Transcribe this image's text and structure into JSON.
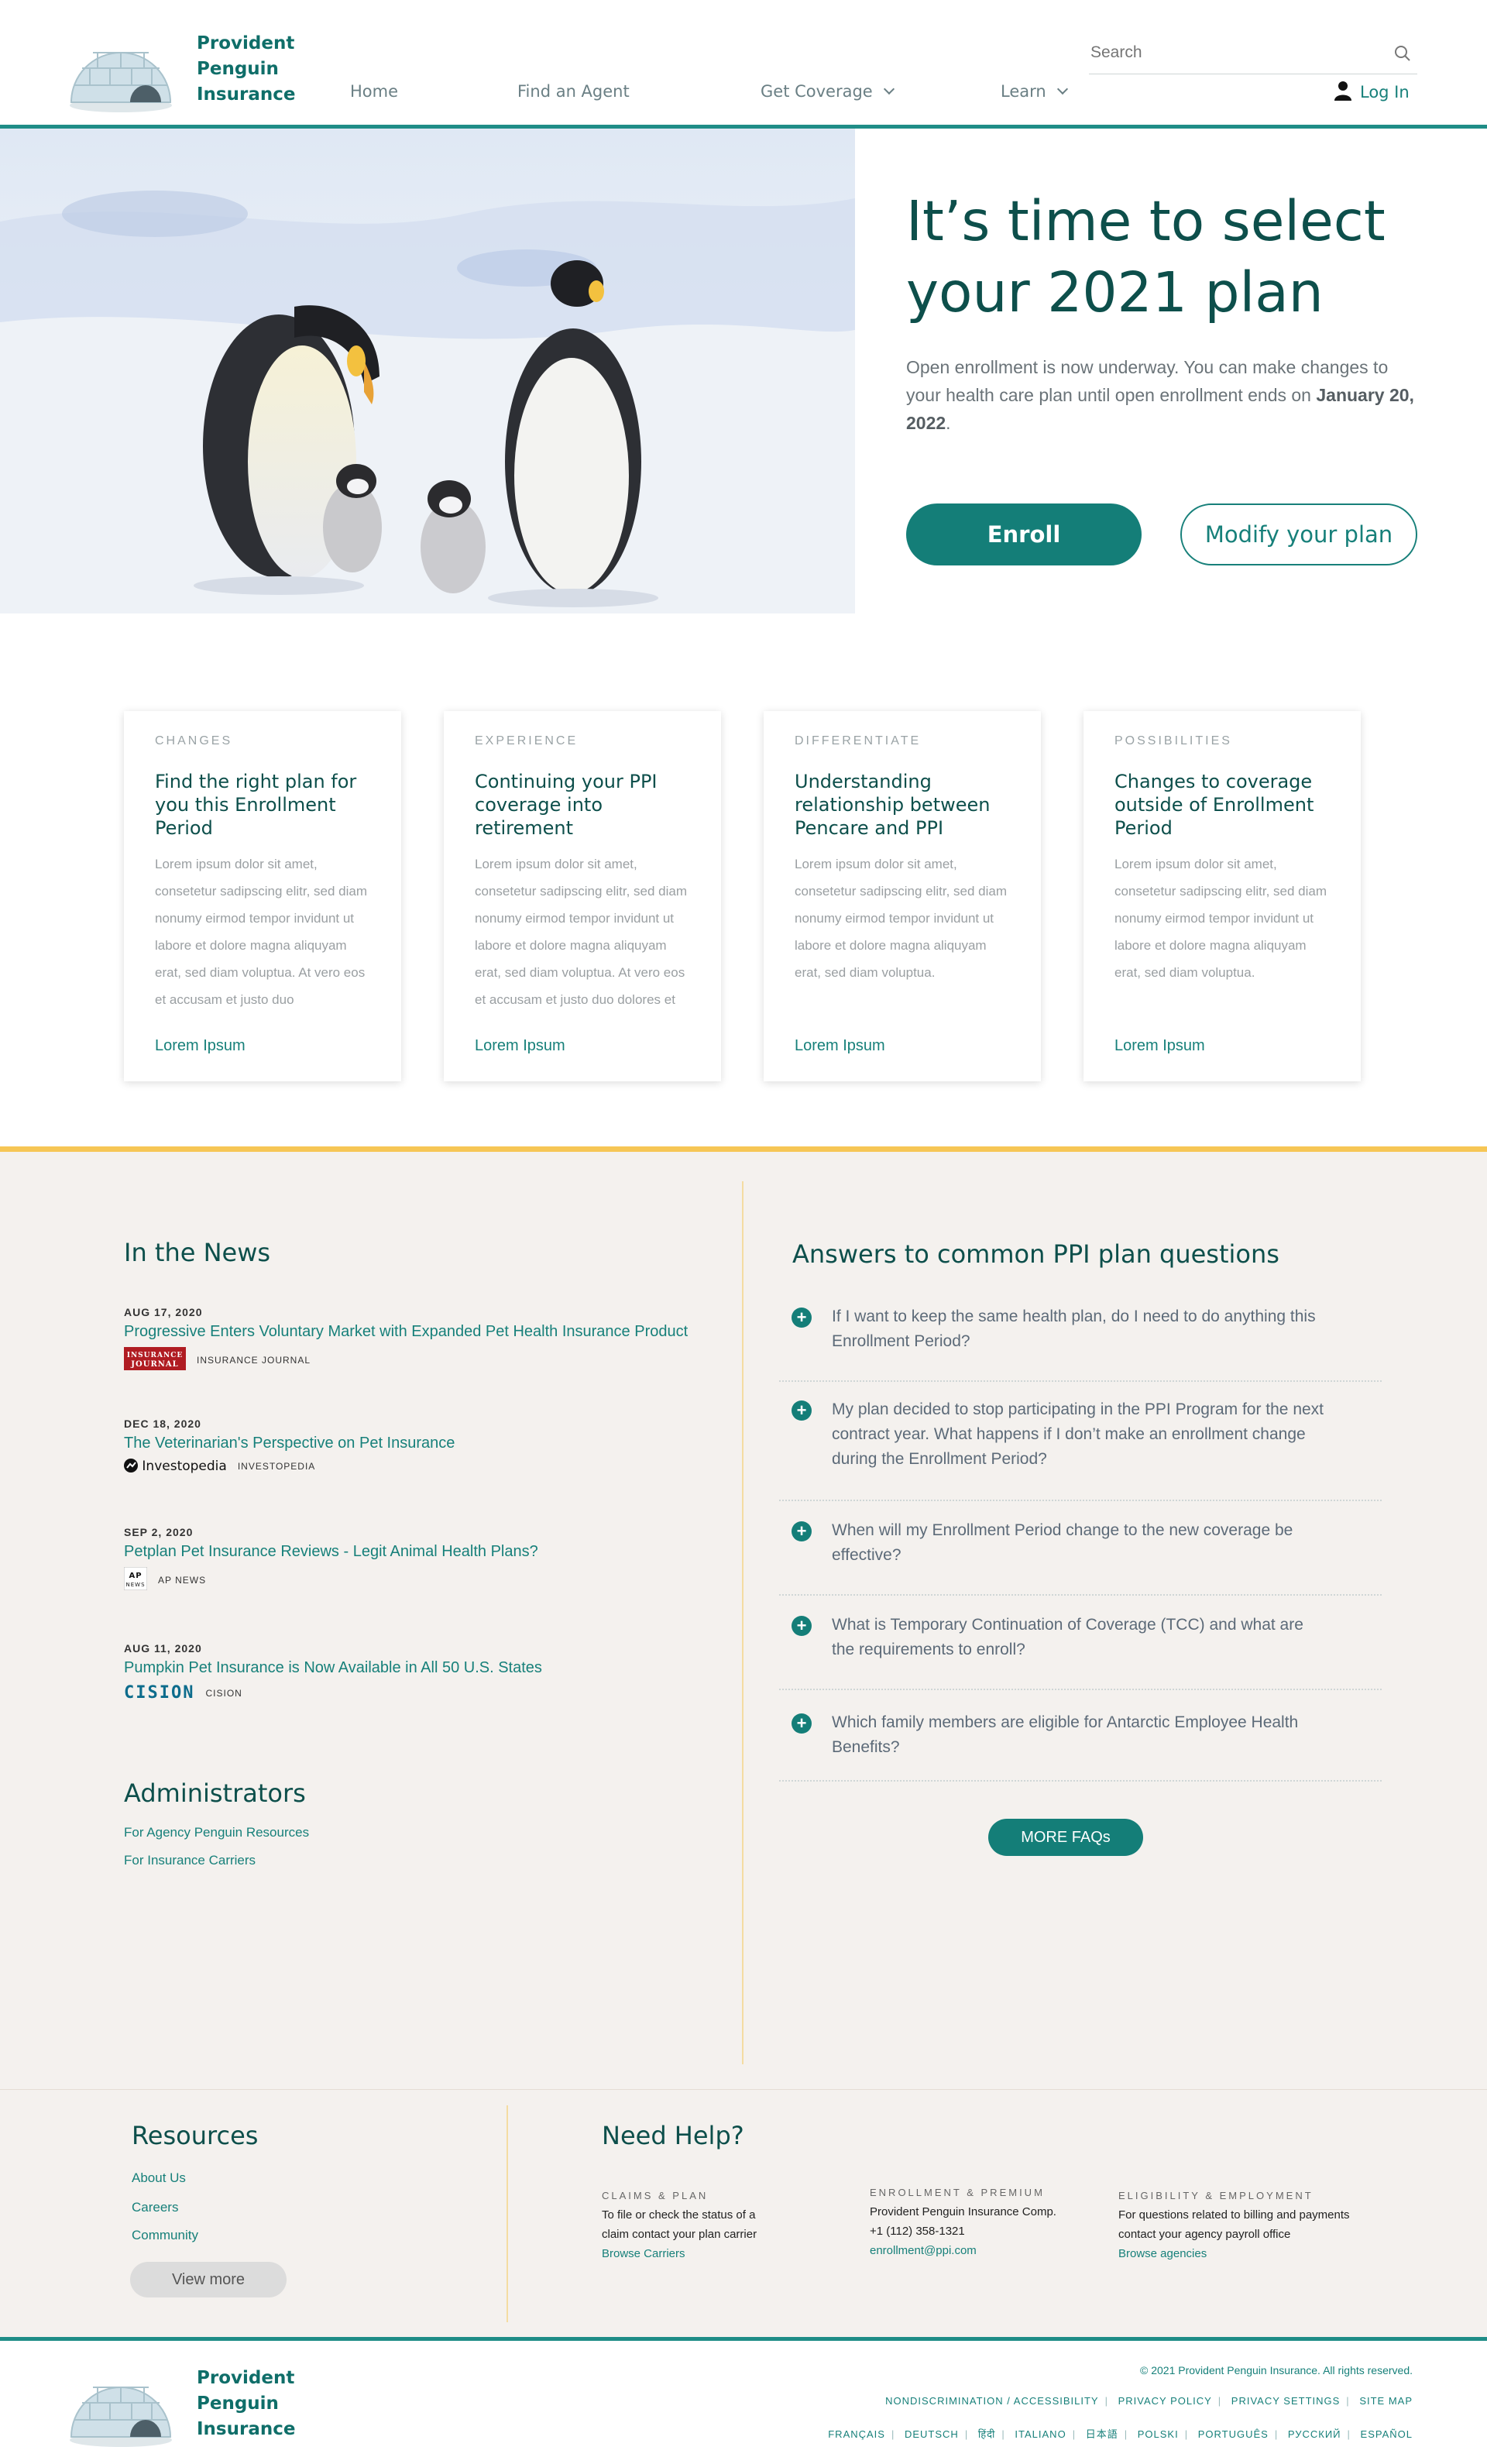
{
  "brand": {
    "line1": "Provident",
    "line2": "Penguin",
    "line3": "Insurance",
    "accent": "#147e78",
    "dark": "#0d4f4b",
    "highlight": "#f6c655"
  },
  "header": {
    "nav": [
      "Home",
      "Find an Agent",
      "Get Coverage",
      "Learn"
    ],
    "search_placeholder": "Search",
    "login": "Log In"
  },
  "hero": {
    "title_line1": "It’s time to select",
    "title_line2": "your 2021 plan",
    "text": "Open enrollment is now underway. You can make changes to your health care plan until open enrollment ends on ",
    "text_bold": "January 20, 2022",
    "text_end": ".",
    "enroll": "Enroll",
    "modify": "Modify your plan"
  },
  "cards": [
    {
      "tag": "CHANGES",
      "title": "Find the right plan for you this Enrollment Period",
      "body": "Lorem ipsum dolor sit amet, consetetur sadipscing elitr, sed diam nonumy eirmod tempor invidunt ut labore et dolore magna aliquyam erat, sed diam voluptua. At vero eos et accusam et justo duo",
      "link": "Lorem Ipsum"
    },
    {
      "tag": "EXPERIENCE",
      "title": "Continuing your PPI coverage into retirement",
      "body": "Lorem ipsum dolor sit amet, consetetur sadipscing elitr, sed diam nonumy eirmod tempor invidunt ut labore et dolore magna aliquyam erat, sed diam voluptua. At vero eos et accusam et justo duo dolores et",
      "link": "Lorem Ipsum"
    },
    {
      "tag": "DIFFERENTIATE",
      "title": "Understanding relationship between Pencare and PPI",
      "body": "Lorem ipsum dolor sit amet, consetetur sadipscing elitr, sed diam nonumy eirmod tempor invidunt ut labore et dolore magna aliquyam erat, sed diam voluptua.",
      "link": "Lorem Ipsum"
    },
    {
      "tag": "POSSIBILITIES",
      "title": "Changes to coverage outside of Enrollment Period",
      "body": "Lorem ipsum dolor sit amet, consetetur sadipscing elitr, sed diam nonumy eirmod tempor invidunt ut labore et dolore magna aliquyam erat, sed diam voluptua.",
      "link": "Lorem Ipsum"
    }
  ],
  "news": {
    "heading": "In the News",
    "items": [
      {
        "date": "AUG 17, 2020",
        "headline": "Progressive Enters Voluntary Market with Expanded Pet Health Insurance Product",
        "source": "INSURANCE JOURNAL"
      },
      {
        "date": "DEC 18, 2020",
        "headline": "The Veterinarian's Perspective on Pet Insurance",
        "source": "INVESTOPEDIA"
      },
      {
        "date": "SEP 2, 2020",
        "headline": "Petplan Pet Insurance Reviews - Legit Animal Health Plans?",
        "source": "AP NEWS"
      },
      {
        "date": "AUG 11, 2020",
        "headline": "Pumpkin Pet Insurance is Now Available in All 50 U.S. States",
        "source": "CISION"
      }
    ],
    "source_logos": {
      "insurance_journal": "INSURANCE JOURNAL",
      "investopedia": "Investopedia",
      "ap": "AP NEWS",
      "cision": "CISION"
    }
  },
  "administrators": {
    "heading": "Administrators",
    "links": [
      "For Agency Penguin Resources",
      "For Insurance Carriers"
    ]
  },
  "faq": {
    "heading": "Answers to common PPI plan questions",
    "items": [
      "If I want to keep the same health plan, do I need to do anything this Enrollment Period?",
      "My plan decided to stop participating in the PPI Program for the next contract year. What happens if I don’t make an enrollment change during the Enrollment Period?",
      "When will my Enrollment Period change to the new coverage be effective?",
      "What is Temporary Continuation of Coverage (TCC) and what are the requirements to enroll?",
      "Which family members are eligible for Antarctic Employee Health Benefits?"
    ],
    "more": "MORE FAQs"
  },
  "resources": {
    "heading": "Resources",
    "links": [
      "About Us",
      "Careers",
      "Community"
    ],
    "view_more": "View more"
  },
  "help": {
    "heading": "Need Help?",
    "claims": {
      "label": "CLAIMS & PLAN",
      "line1": "To file or check the status of a",
      "line2": "claim contact your plan carrier",
      "link": "Browse Carriers"
    },
    "enrollment": {
      "label": "ENROLLMENT & PREMIUM",
      "line1": "Provident Penguin Insurance Comp.",
      "line2": "+1 (112) 358-1321",
      "link": "enrollment@ppi.com"
    },
    "eligibility": {
      "label": "ELIGIBILITY & EMPLOYMENT",
      "line1": "For questions related to billing and payments",
      "line2": "contact your agency payroll office",
      "link": "Browse agencies"
    }
  },
  "footer": {
    "copyright": "© 2021 Provident Penguin Insurance. All rights reserved.",
    "links": [
      "NONDISCRIMINATION / ACCESSIBILITY",
      "PRIVACY POLICY",
      "PRIVACY SETTINGS",
      "SITE MAP"
    ],
    "languages": [
      "FRANÇAIS",
      "DEUTSCH",
      "हिंदी",
      "ITALIANO",
      "日本語",
      "POLSKI",
      "PORTUGUÊS",
      "РУССКИЙ",
      "ESPAÑOL"
    ]
  }
}
